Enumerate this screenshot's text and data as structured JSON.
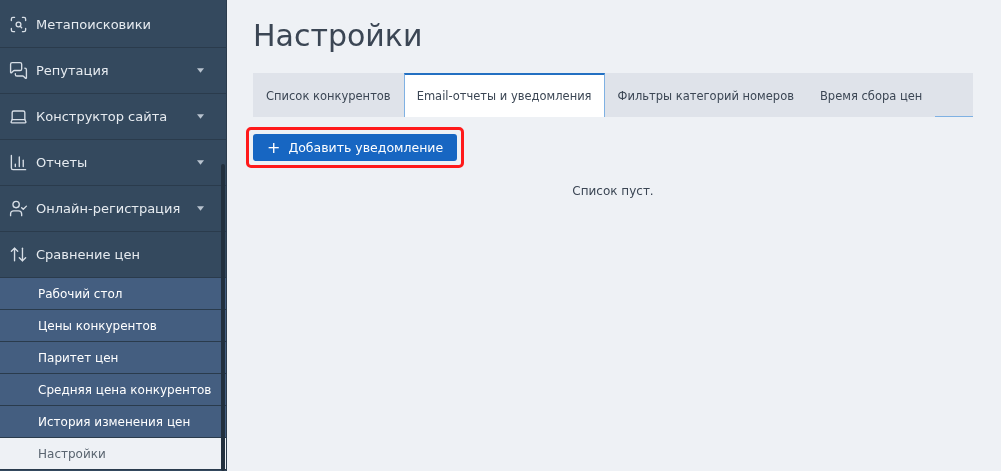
{
  "sidebar": {
    "items": [
      {
        "label": "Метапоисковики",
        "has_caret": false
      },
      {
        "label": "Репутация",
        "has_caret": true
      },
      {
        "label": "Конструктор сайта",
        "has_caret": true
      },
      {
        "label": "Отчеты",
        "has_caret": true
      },
      {
        "label": "Онлайн-регистрация",
        "has_caret": true
      },
      {
        "label": "Сравнение цен",
        "has_caret": false,
        "expanded": true,
        "children": [
          {
            "label": "Рабочий стол",
            "selected": false
          },
          {
            "label": "Цены конкурентов",
            "selected": false
          },
          {
            "label": "Паритет цен",
            "selected": false
          },
          {
            "label": "Средняя цена конкурентов",
            "selected": false
          },
          {
            "label": "История изменения цен",
            "selected": false
          },
          {
            "label": "Настройки",
            "selected": true
          }
        ]
      }
    ]
  },
  "page": {
    "title": "Настройки",
    "tabs": [
      {
        "label": "Список конкурентов",
        "selected": false
      },
      {
        "label": "Email-отчеты и уведомления",
        "selected": true
      },
      {
        "label": "Фильтры категорий номеров",
        "selected": false
      },
      {
        "label": "Время сбора цен",
        "selected": false
      }
    ],
    "add_button": {
      "icon": "+",
      "label": "Добавить уведомление",
      "highlighted": true
    },
    "empty_message": "Список пуст."
  }
}
